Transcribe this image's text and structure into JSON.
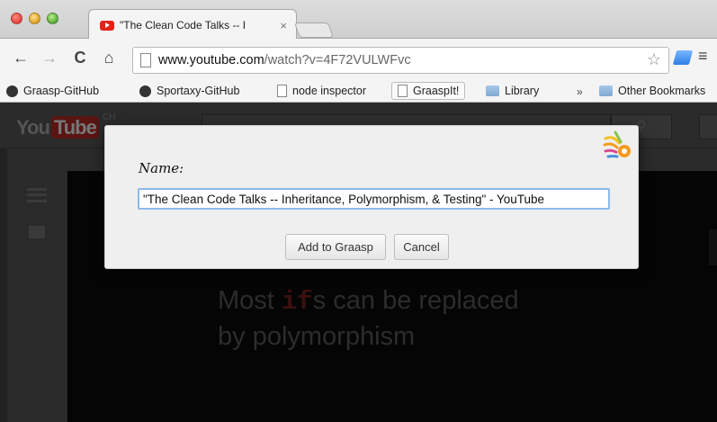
{
  "browser": {
    "tabs": [
      {
        "title": "\"The Clean Code Talks -- I",
        "close": "×"
      }
    ],
    "toolbar": {
      "back": "←",
      "forward": "→",
      "reload": "C",
      "home": "⌂",
      "url_host": "www.youtube.com",
      "url_path": "/watch?v=4F72VULWFvc",
      "star": "☆",
      "menu": "≡"
    },
    "bookmarks": [
      {
        "label": "Graasp-GitHub",
        "icon": "github-icon"
      },
      {
        "label": "Sportaxy-GitHub",
        "icon": "github-icon"
      },
      {
        "label": "node inspector",
        "icon": "page-icon"
      },
      {
        "label": "GraaspIt!",
        "icon": "page-icon"
      },
      {
        "label": "Library",
        "icon": "folder-icon"
      },
      {
        "label": "Other Bookmarks",
        "icon": "folder-icon"
      }
    ],
    "bookmarks_overflow": "»"
  },
  "youtube": {
    "logo_you": "You",
    "logo_tube": "Tube",
    "region": "CH",
    "slide_line1_a": "Most ",
    "slide_keyword": "if",
    "slide_line1_b": "s can be replaced",
    "slide_line2": "by polymorphism"
  },
  "dialog": {
    "label": "Name:",
    "name_value": "\"The Clean Code Talks -- Inheritance, Polymorphism, & Testing\" - YouTube",
    "add_label": "Add to Graasp",
    "cancel_label": "Cancel"
  },
  "colors": {
    "input_focus": "#8fb8ea",
    "youtube_red": "#e62117",
    "graasp_orange": "#f29a1f"
  }
}
